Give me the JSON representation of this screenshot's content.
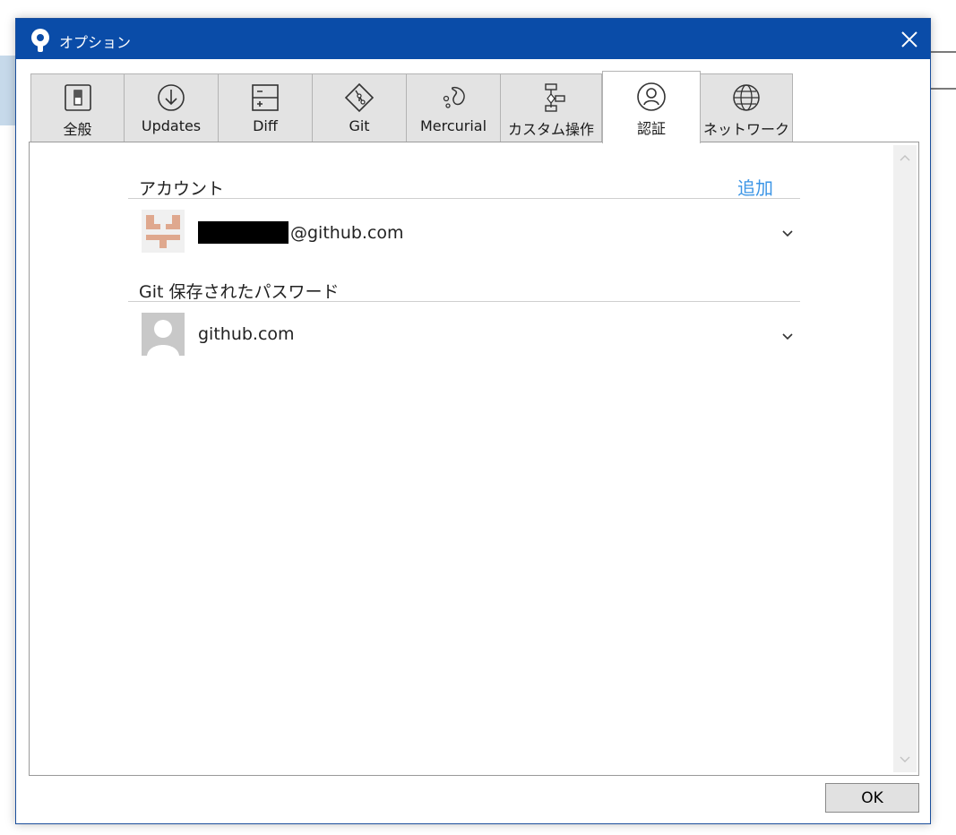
{
  "window": {
    "title": "オプション"
  },
  "tabs": [
    {
      "label": "全般",
      "icon": "switch-icon"
    },
    {
      "label": "Updates",
      "icon": "download-icon"
    },
    {
      "label": "Diff",
      "icon": "diff-icon"
    },
    {
      "label": "Git",
      "icon": "git-icon"
    },
    {
      "label": "Mercurial",
      "icon": "mercurial-icon"
    },
    {
      "label": "カスタム操作",
      "icon": "custom-actions-icon"
    },
    {
      "label": "認証",
      "icon": "user-icon",
      "active": true
    },
    {
      "label": "ネットワーク",
      "icon": "globe-icon"
    }
  ],
  "accounts": {
    "title": "アカウント",
    "add_label": "追加",
    "items": [
      {
        "text": "@github.com",
        "avatar": "identicon-avatar"
      }
    ]
  },
  "git_passwords": {
    "title": "Git 保存されたパスワード",
    "items": [
      {
        "text": "github.com",
        "avatar": "default-user-avatar"
      }
    ]
  },
  "buttons": {
    "ok": "OK"
  },
  "colors": {
    "titlebar": "#0a4ca8",
    "link": "#3b95e6",
    "identicon": "#dfa88e"
  }
}
